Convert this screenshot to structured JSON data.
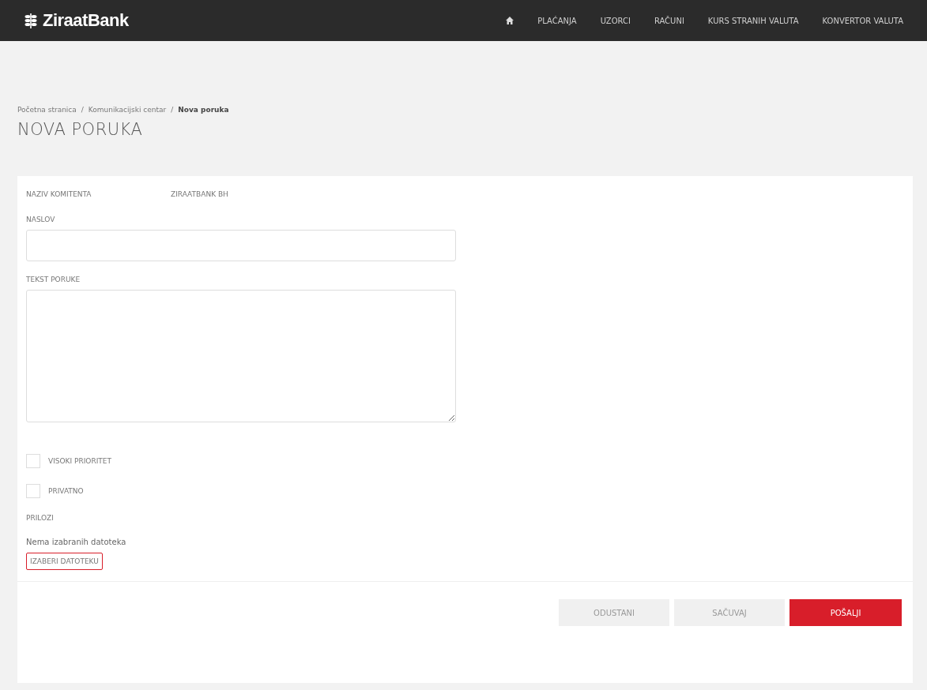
{
  "header": {
    "logo": "ZiraatBank",
    "nav": [
      {
        "kind": "home"
      },
      {
        "kind": "text",
        "label": "PLAĆANJA"
      },
      {
        "kind": "text",
        "label": "UZORCI"
      },
      {
        "kind": "text",
        "label": "RAČUNI"
      },
      {
        "kind": "text",
        "label": "KURS STRANIH VALUTA"
      },
      {
        "kind": "text",
        "label": "KONVERTOR VALUTA"
      }
    ]
  },
  "breadcrumb": [
    {
      "kind": "link",
      "text": "Početna stranica"
    },
    {
      "kind": "separator",
      "text": "/"
    },
    {
      "kind": "link",
      "text": "Komunikacijski centar"
    },
    {
      "kind": "separator",
      "text": "/"
    },
    {
      "kind": "current",
      "text": "Nova poruka"
    }
  ],
  "title": "NOVA PORUKA",
  "form": {
    "client_label": "NAZIV KOMITENTA",
    "client_value": "ZIRAATBANK BH",
    "subject": {
      "label": "NASLOV"
    },
    "message": {
      "label": "TEKST PORUKE"
    },
    "options": [
      {
        "label": "VISOKI PRIORITET",
        "checked": false
      },
      {
        "label": "PRIVATNO",
        "checked": false
      }
    ],
    "attachments": {
      "label": "PRILOZI",
      "status": "Nema izabranih datoteka",
      "button": "IZABERI DATOTEKU"
    }
  },
  "actions": [
    {
      "kind": "secondary",
      "label": "ODUSTANI"
    },
    {
      "kind": "secondary",
      "label": "SAČUVAJ"
    },
    {
      "kind": "primary",
      "label": "POŠALJI"
    }
  ]
}
